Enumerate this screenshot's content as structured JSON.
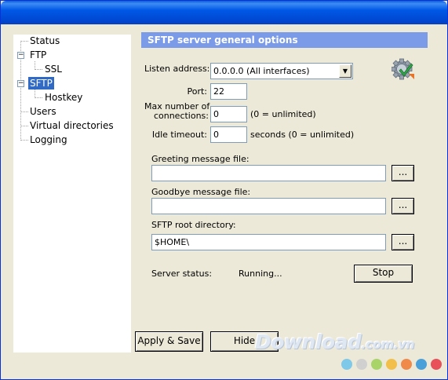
{
  "tree": {
    "items": [
      {
        "label": "Status"
      },
      {
        "label": "FTP"
      },
      {
        "label": "SSL"
      },
      {
        "label": "SFTP"
      },
      {
        "label": "Hostkey"
      },
      {
        "label": "Users"
      },
      {
        "label": "Virtual directories"
      },
      {
        "label": "Logging"
      }
    ],
    "selected": "SFTP"
  },
  "panel": {
    "title": "SFTP server general options",
    "listen_address_label": "Listen address:",
    "listen_address_value": "0.0.0.0 (All interfaces)",
    "port_label": "Port:",
    "port_value": "22",
    "max_conn_label_1": "Max number of",
    "max_conn_label_2": "connections:",
    "max_conn_value": "0",
    "max_conn_hint": "(0 = unlimited)",
    "idle_timeout_label": "Idle timeout:",
    "idle_timeout_value": "0",
    "idle_timeout_hint": "seconds (0 = unlimited)",
    "greeting_label": "Greeting message file:",
    "greeting_value": "",
    "goodbye_label": "Goodbye message file:",
    "goodbye_value": "",
    "root_dir_label": "SFTP root directory:",
    "root_dir_value": "$HOME\\",
    "browse_label": "...",
    "server_status_label": "Server status:",
    "server_status_value": "Running...",
    "stop_label": "Stop"
  },
  "footer": {
    "apply_label": "Apply & Save",
    "hide_label": "Hide"
  },
  "watermark": {
    "text": "Download",
    "suffix": ".com.vn",
    "dot_colors": [
      "#7ec8ea",
      "#d0d0d0",
      "#a8d46a",
      "#f2c04a",
      "#f08a4a",
      "#4aa0d8",
      "#e8505a"
    ]
  },
  "colors": {
    "title_bar": "#0058e6",
    "header_bg": "#7b9ae8",
    "selection": "#316ac5",
    "dialog_bg": "#ece9d8"
  }
}
